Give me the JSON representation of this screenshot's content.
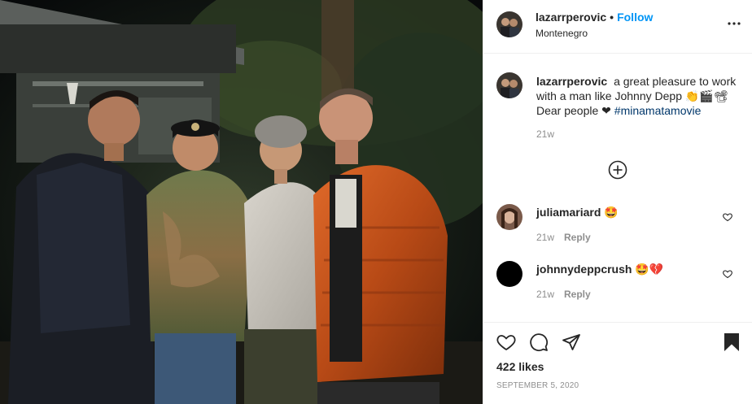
{
  "post": {
    "username": "lazarrperovic",
    "separator": "•",
    "follow_label": "Follow",
    "location": "Montenegro",
    "more_icon": "more-horizontal-icon"
  },
  "caption": {
    "username": "lazarrperovic",
    "text": "a great pleasure to work with a man like Johnny Depp 👏🎬📽 Dear people ❤",
    "hashtag": "#minamatamovie",
    "time": "21w"
  },
  "comments": [
    {
      "username": "juliamariard",
      "text": "🤩",
      "time": "21w",
      "reply_label": "Reply"
    },
    {
      "username": "johnnydeppcrush",
      "text": "🤩💔",
      "time": "21w",
      "reply_label": "Reply"
    }
  ],
  "engagement": {
    "likes": "422 likes",
    "date": "September 5, 2020"
  },
  "colors": {
    "link_blue": "#0095f6",
    "hashtag": "#00376b",
    "muted": "#8e8e8e",
    "text": "#262626",
    "border": "#efefef"
  },
  "icons": [
    "like-heart-icon",
    "comment-icon",
    "share-icon",
    "save-bookmark-icon",
    "load-more-icon",
    "comment-like-icon"
  ]
}
